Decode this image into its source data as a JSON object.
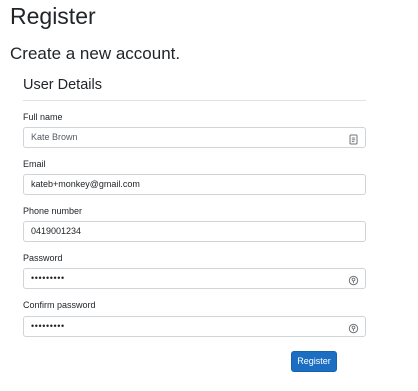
{
  "page": {
    "title": "Register",
    "subtitle": "Create a new account."
  },
  "section": {
    "title": "User Details"
  },
  "fields": {
    "full_name": {
      "label": "Full name",
      "value": "Kate Brown",
      "icon": "contact-card-icon"
    },
    "email": {
      "label": "Email",
      "value": "kateb+monkey@gmail.com"
    },
    "phone": {
      "label": "Phone number",
      "value": "0419001234"
    },
    "password": {
      "label": "Password",
      "value": "•••••••••",
      "icon": "key-icon"
    },
    "confirm_password": {
      "label": "Confirm password",
      "value": "•••••••••",
      "icon": "key-icon"
    }
  },
  "actions": {
    "register_label": "Register"
  },
  "colors": {
    "primary": "#1b6ec2",
    "border": "#ced4da",
    "rule": "#dee2e6"
  }
}
